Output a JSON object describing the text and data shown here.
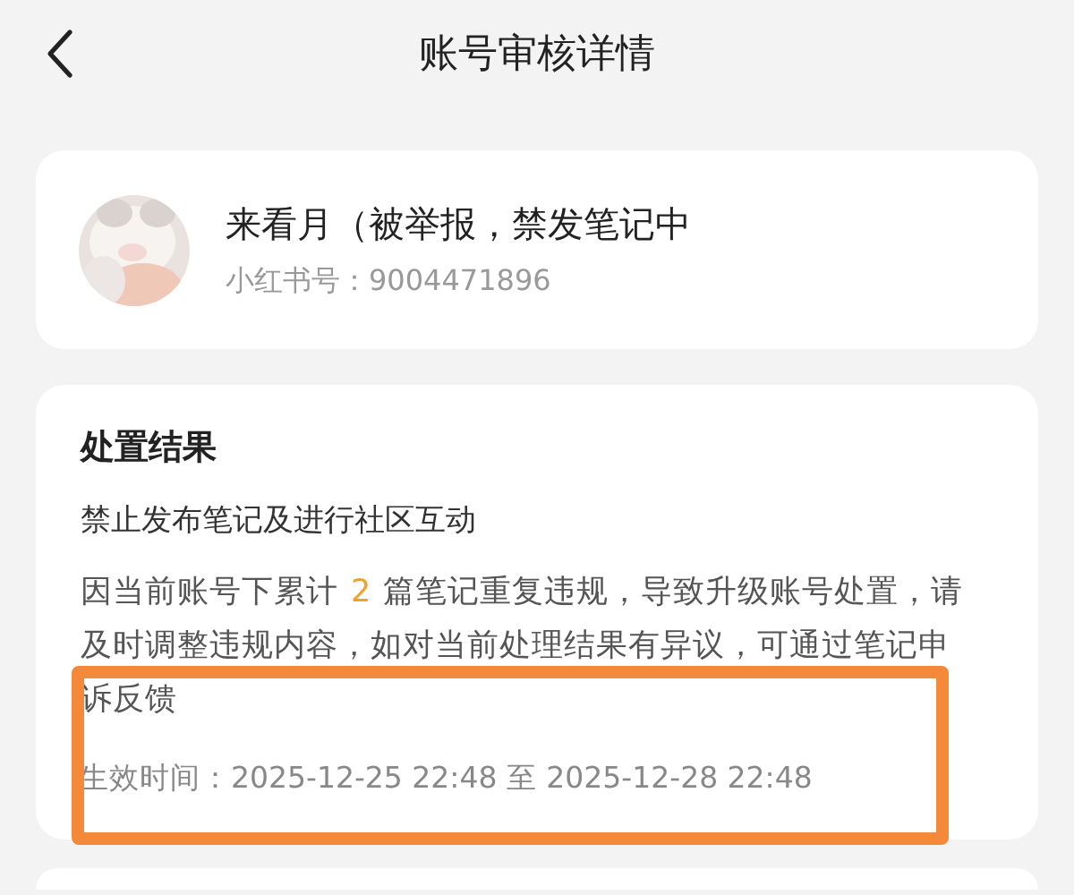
{
  "header": {
    "title": "账号审核详情"
  },
  "account": {
    "name": "来看月（被举报，禁发笔记中",
    "id_line": "小红书号：9004471896"
  },
  "result": {
    "heading": "处置结果",
    "summary": "禁止发布笔记及进行社区互动",
    "notice": {
      "before": "因当前账号下累计",
      "count": "2",
      "after": "篇笔记重复违规，导致升级账号处置，请及时调整违规内容，如对当前处理结果有异议，可通过笔记申诉反馈"
    },
    "period": "生效时间：2025-12-25 22:48 至 2025-12-28 22:48",
    "highlight_frame": true
  }
}
